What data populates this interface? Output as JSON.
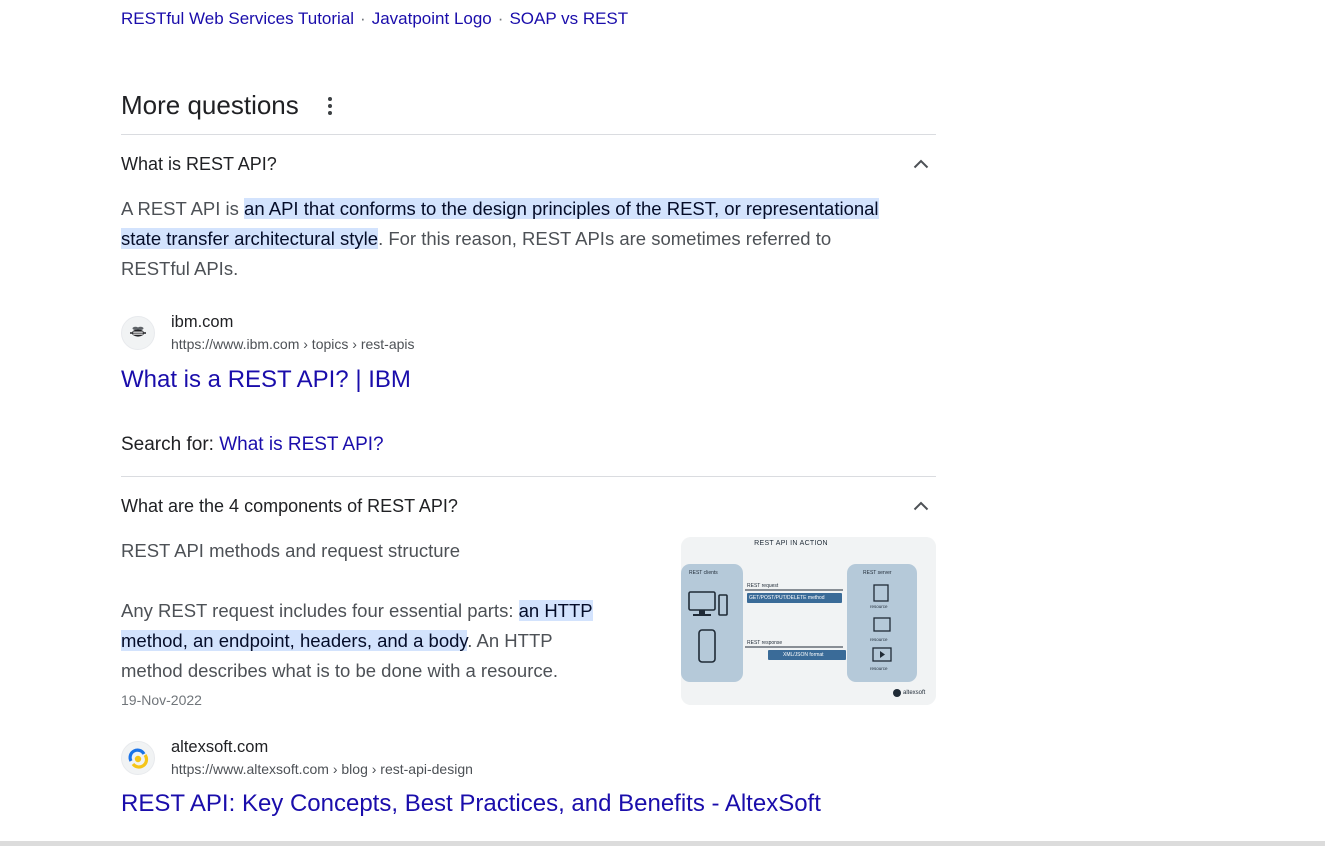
{
  "related": {
    "links": [
      "RESTful Web Services Tutorial",
      "Javatpoint Logo",
      "SOAP vs REST"
    ],
    "separator": "·"
  },
  "more_questions": {
    "title": "More questions",
    "menu_icon": "more-vert-icon"
  },
  "q1": {
    "question": "What is REST API?",
    "answer_pre": "A REST API is ",
    "answer_highlight_line1": "an API that conforms to the design principles of the REST, or representational",
    "answer_highlight_line2": "state transfer architectural style",
    "answer_post_line2": ". For this reason, REST APIs are sometimes referred to",
    "answer_line3": "RESTful APIs.",
    "source": {
      "name": "ibm.com",
      "url": "https://www.ibm.com › topics › rest-apis",
      "icon": "ibm-bee-icon"
    },
    "result_title": "What is a REST API? | IBM"
  },
  "search_for": {
    "prefix": "Search for: ",
    "link": "What is REST API?"
  },
  "q2": {
    "question": "What are the 4 components of REST API?",
    "heading": "REST API methods and request structure",
    "body_pre": "Any REST request includes four essential parts: ",
    "body_hl_line1": "an HTTP",
    "body_hl_line2": "method, an endpoint, headers, and a body",
    "body_post_line2": ". An HTTP",
    "body_line3": "method describes what is to be done with a resource.",
    "date": "19-Nov-2022",
    "image": {
      "title": "REST API IN ACTION",
      "clients_label": "REST clients",
      "server_label": "REST server",
      "request_label": "REST request",
      "request_method": "GET/POST/PUT/DELETE method",
      "response_label": "REST response",
      "response_format": "XML/JSON format",
      "resource_label": "resource",
      "brand": "altexsoft"
    },
    "source": {
      "name": "altexsoft.com",
      "url": "https://www.altexsoft.com › blog › rest-api-design",
      "icon": "altexsoft-logo-icon"
    },
    "result_title": "REST API: Key Concepts, Best Practices, and Benefits - AltexSoft"
  }
}
